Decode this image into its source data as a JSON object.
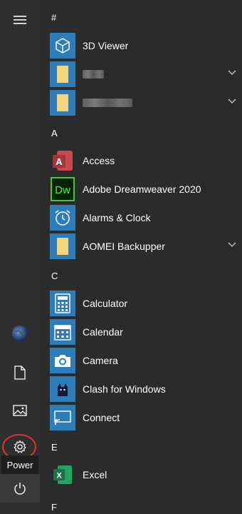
{
  "headers": {
    "hash": "#",
    "a": "A",
    "c": "C",
    "e": "E",
    "f": "F"
  },
  "apps": {
    "viewer3d": "3D Viewer",
    "access": "Access",
    "dreamweaver": "Adobe Dreamweaver 2020",
    "dreamweaver_tile_text": "Dw",
    "access_tile_text": "A",
    "alarms": "Alarms & Clock",
    "aomei": "AOMEI Backupper",
    "calculator": "Calculator",
    "calendar": "Calendar",
    "camera": "Camera",
    "clash": "Clash for Windows",
    "connect": "Connect",
    "excel": "Excel",
    "excel_tile_text": "X"
  },
  "rail": {
    "power_tooltip": "Power"
  },
  "colors": {
    "tile_blue": "#2d7db8",
    "folder_yellow": "#f5d37a",
    "access_red": "#a4373a",
    "dreamweaver_green": "#4cf04c",
    "excel_green": "#1e7145",
    "highlight_red": "#e23030"
  }
}
